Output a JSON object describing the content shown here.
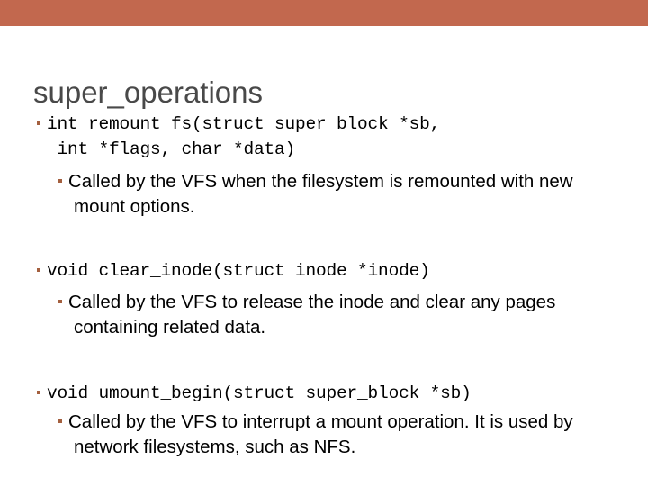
{
  "slide": {
    "title": "super_operations",
    "banner_color": "#c2684e",
    "title_color": "#494949",
    "bullet_color": "#a4603f",
    "body_text_color": "#000000",
    "background_color": "#ffffff"
  },
  "content": {
    "groups": [
      {
        "signature": "int remount_fs(struct super_block *sb,\n int *flags, char *data)",
        "description": "Called by the VFS when the filesystem is remounted with new mount options."
      },
      {
        "signature": "void clear_inode(struct inode *inode)",
        "description": "Called by the VFS to release the inode and clear any pages containing related data."
      },
      {
        "signature": "void umount_begin(struct super_block *sb)",
        "description": "Called by the VFS to interrupt a mount operation. It is used by network filesystems, such as NFS."
      }
    ]
  }
}
